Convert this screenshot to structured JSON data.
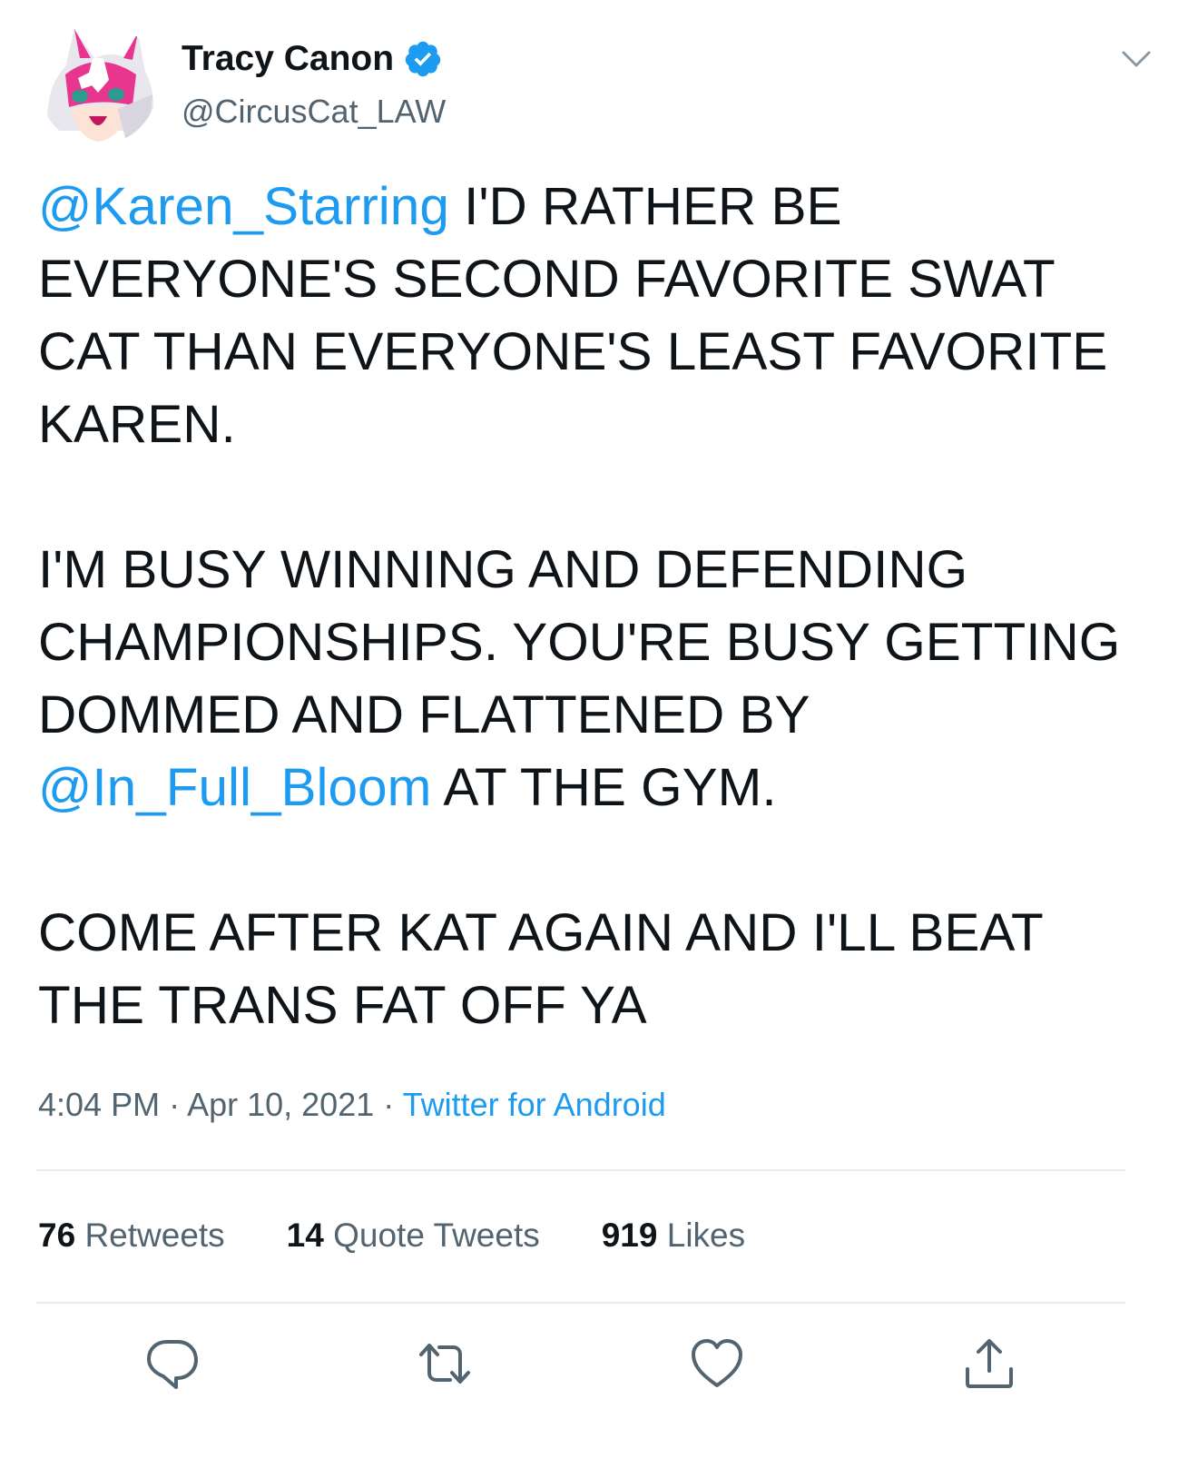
{
  "header": {
    "display_name": "Tracy Canon",
    "handle": "@CircusCat_LAW",
    "verified": true
  },
  "tweet": {
    "paragraph1": {
      "mention": "@Karen_Starring",
      "text": " I'D RATHER BE EVERYONE'S SECOND FAVORITE SWAT CAT THAN EVERYONE'S LEAST FAVORITE KAREN."
    },
    "paragraph2": {
      "text_before": "I'M BUSY WINNING AND DEFENDING CHAMPIONSHIPS. YOU'RE BUSY GETTING DOMMED AND FLATTENED BY ",
      "mention": "@In_Full_Bloom",
      "text_after": " AT THE GYM."
    },
    "paragraph3": {
      "text": "COME AFTER KAT AGAIN AND I'LL BEAT THE TRANS FAT OFF YA"
    }
  },
  "meta": {
    "time": "4:04 PM",
    "separator": " · ",
    "date": "Apr 10, 2021",
    "source": "Twitter for Android"
  },
  "stats": {
    "retweets_count": "76",
    "retweets_label": "Retweets",
    "quotes_count": "14",
    "quotes_label": "Quote Tweets",
    "likes_count": "919",
    "likes_label": "Likes"
  },
  "icons": {
    "verified": "verified-badge-icon",
    "more": "chevron-down-icon",
    "reply": "reply-icon",
    "retweet": "retweet-icon",
    "like": "heart-icon",
    "share": "share-icon"
  },
  "colors": {
    "link": "#1d9bf0",
    "text": "#0f1419",
    "secondary": "#536471",
    "divider": "#e6ecf0",
    "avatar_pink": "#e8368f"
  }
}
